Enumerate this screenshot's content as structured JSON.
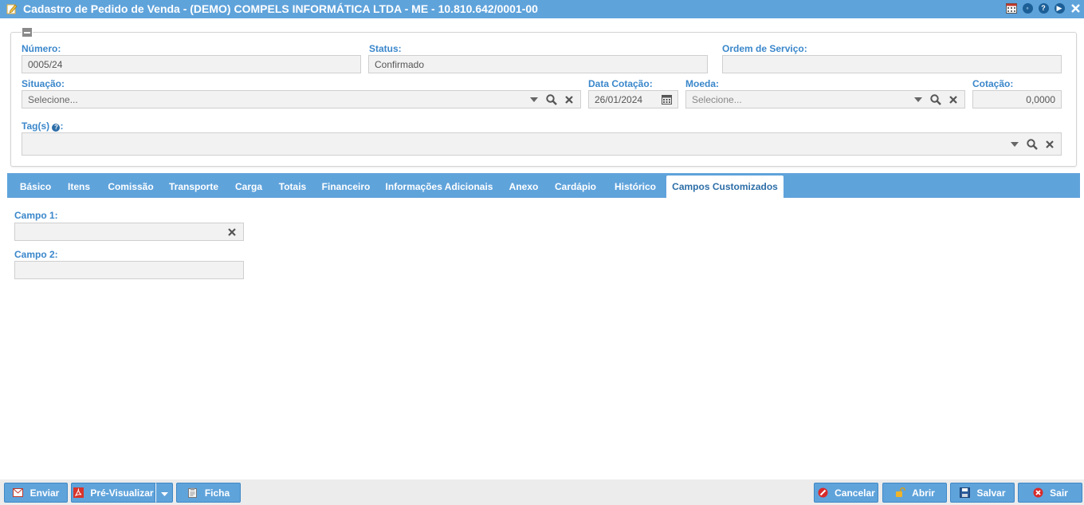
{
  "window": {
    "title": "Cadastro de Pedido de Venda - (DEMO) COMPELS INFORMÁTICA LTDA - ME - 10.810.642/0001-00"
  },
  "header_form": {
    "numero_label": "Número:",
    "numero_value": "0005/24",
    "status_label": "Status:",
    "status_value": "Confirmado",
    "ordem_label": "Ordem de Serviço:",
    "ordem_value": "",
    "situacao_label": "Situação:",
    "situacao_value": "Selecione...",
    "data_cotacao_label": "Data Cotação:",
    "data_cotacao_value": "26/01/2024",
    "moeda_label": "Moeda:",
    "moeda_placeholder": "Selecione...",
    "cotacao_label": "Cotação:",
    "cotacao_value": "0,0000",
    "tags_label": "Tag(s)",
    "tags_suffix": ":"
  },
  "tabs": [
    {
      "label": "Básico"
    },
    {
      "label": "Itens"
    },
    {
      "label": "Comissão"
    },
    {
      "label": "Transporte"
    },
    {
      "label": "Carga"
    },
    {
      "label": "Totais"
    },
    {
      "label": "Financeiro"
    },
    {
      "label": "Informações Adicionais"
    },
    {
      "label": "Anexo"
    },
    {
      "label": "Cardápio"
    },
    {
      "label": "Histórico"
    },
    {
      "label": "Campos Customizados",
      "active": true
    }
  ],
  "custom_fields": {
    "campo1_label": "Campo 1:",
    "campo1_value": "",
    "campo2_label": "Campo 2:",
    "campo2_value": ""
  },
  "footer": {
    "enviar": "Enviar",
    "previsualizar": "Pré-Visualizar",
    "ficha": "Ficha",
    "cancelar": "Cancelar",
    "abrir": "Abrir",
    "salvar": "Salvar",
    "sair": "Sair"
  },
  "colors": {
    "accent": "#5fa3db",
    "label": "#3a87cb",
    "input_bg": "#f2f2f2"
  },
  "icons": [
    "edit-icon",
    "calendar-icon",
    "settings-icon",
    "help-icon",
    "play-icon",
    "close-icon",
    "search-icon",
    "clear-icon",
    "dropdown-icon",
    "mail-icon",
    "pdf-icon",
    "clipboard-icon",
    "cancel-icon",
    "unlock-icon",
    "save-icon",
    "exit-icon"
  ]
}
